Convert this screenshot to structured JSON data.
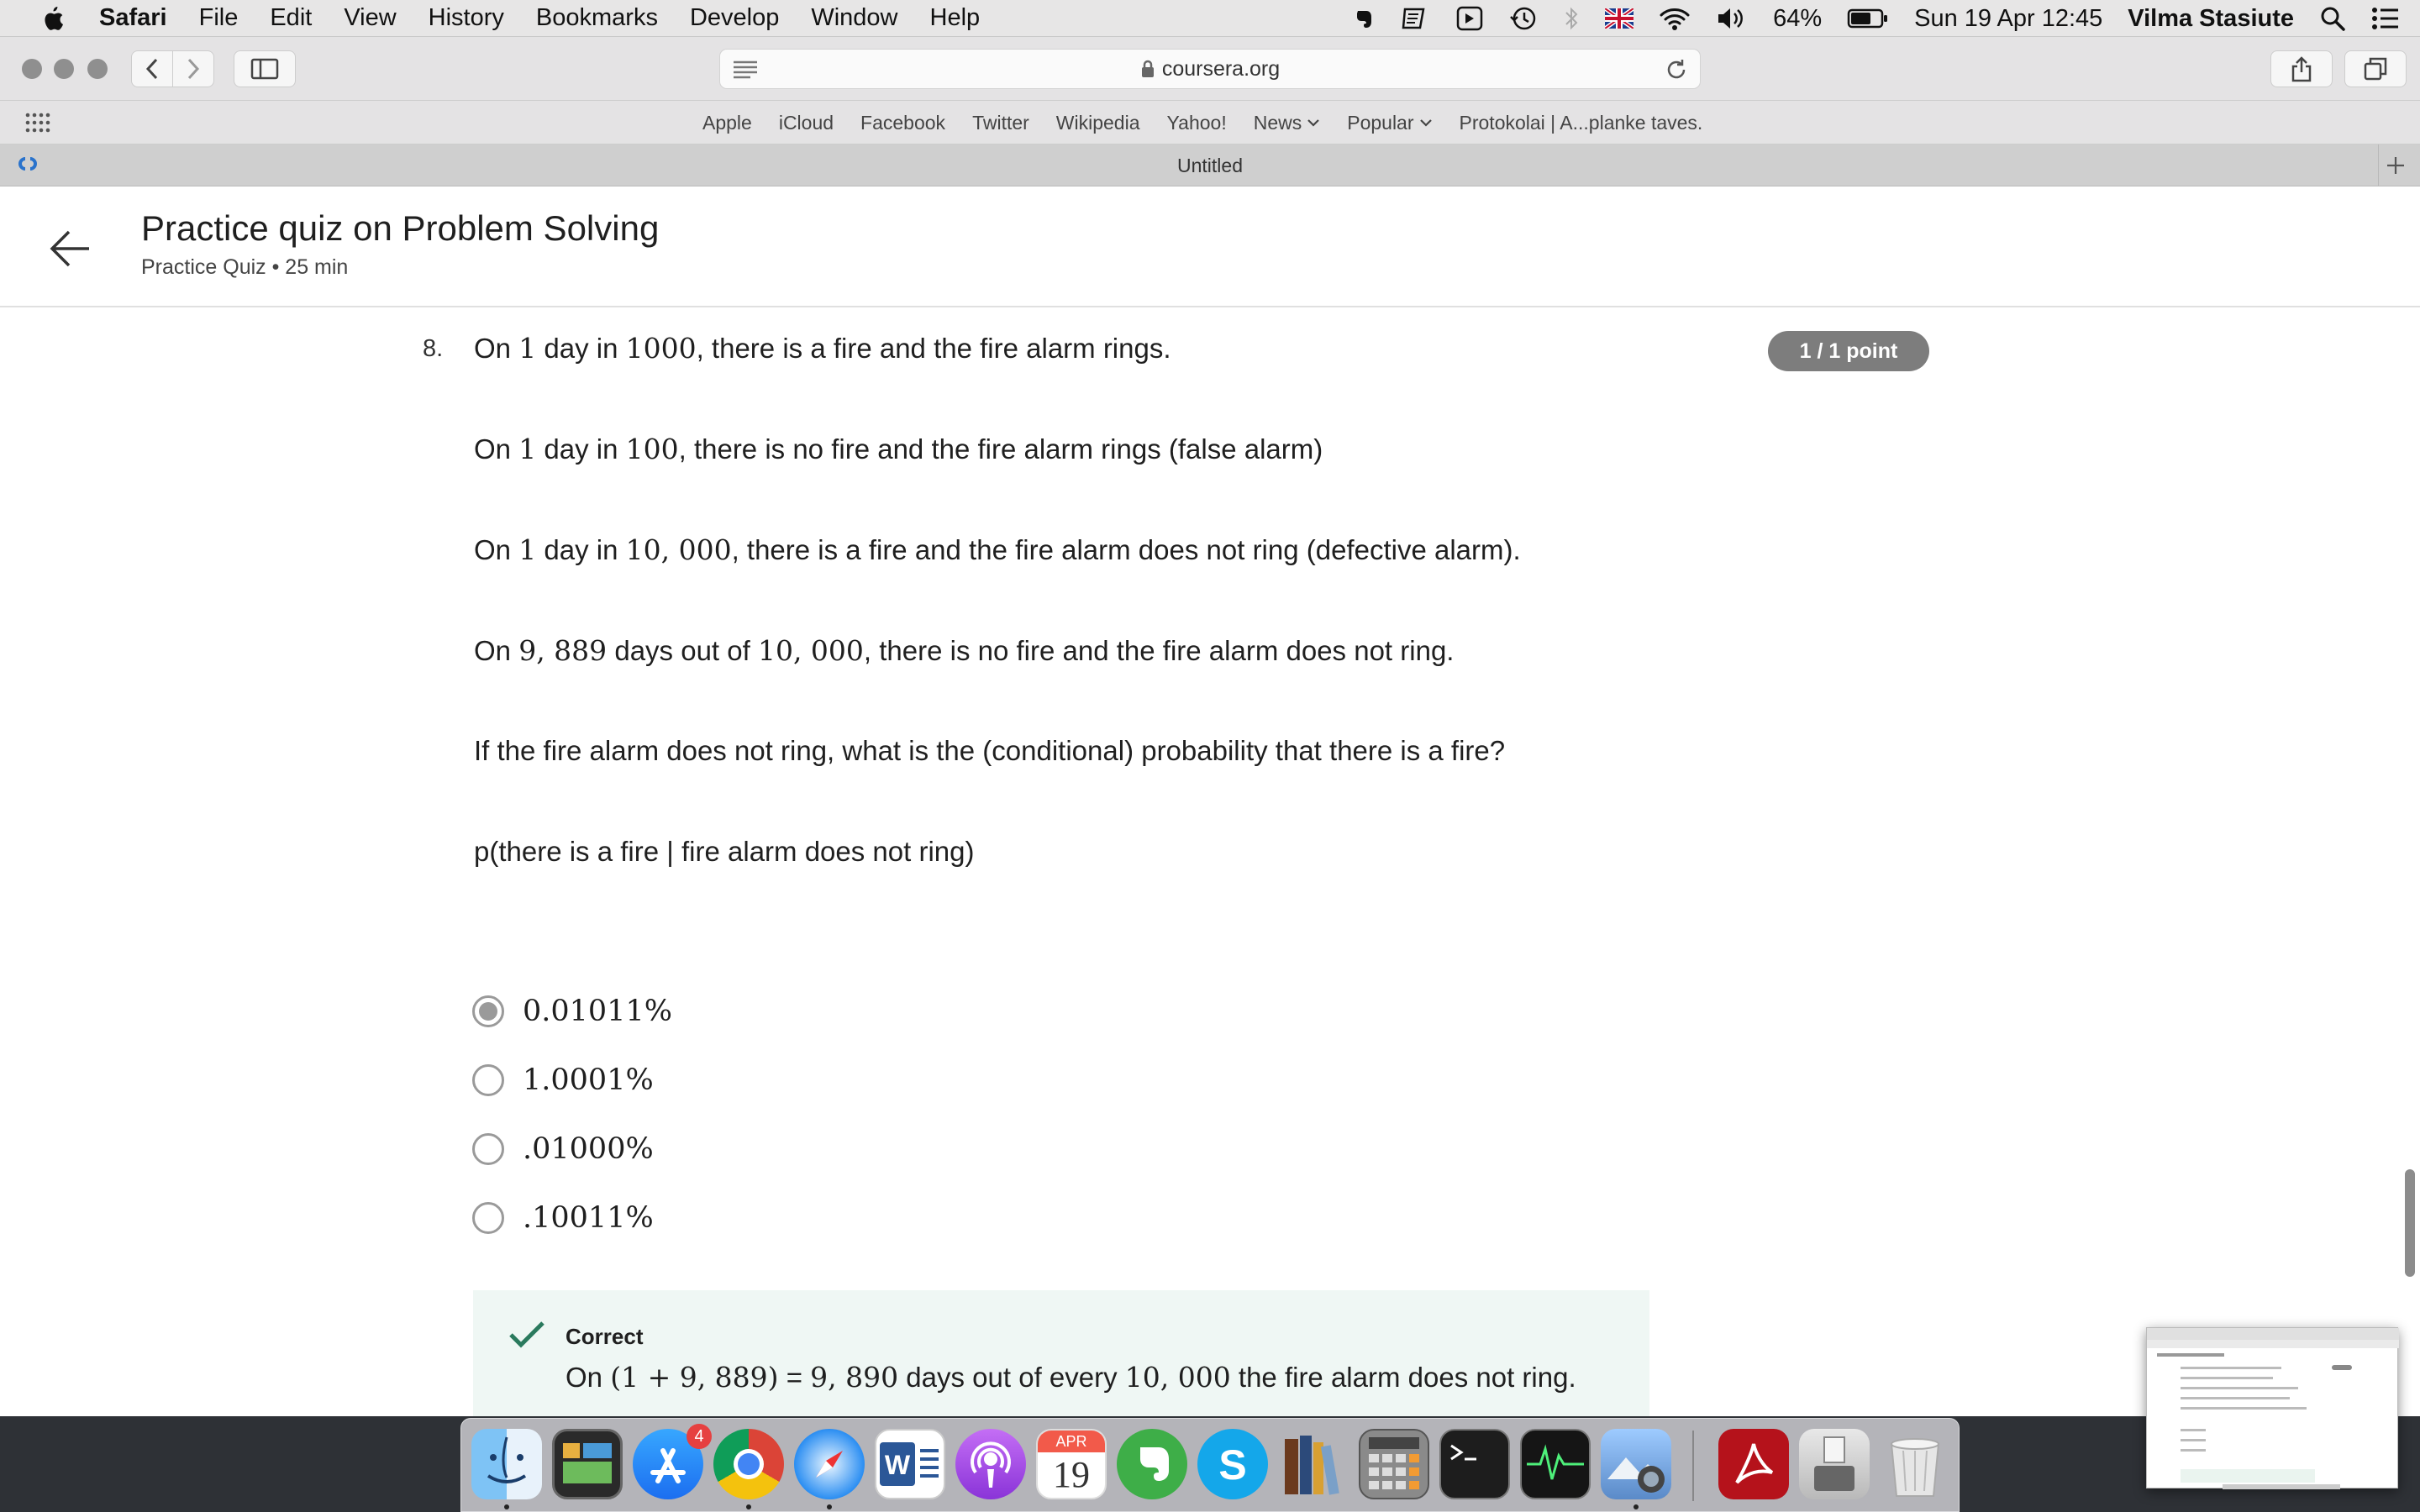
{
  "menubar": {
    "app_name": "Safari",
    "items": [
      "File",
      "Edit",
      "View",
      "History",
      "Bookmarks",
      "Develop",
      "Window",
      "Help"
    ],
    "battery": "64%",
    "datetime": "Sun 19 Apr  12:45",
    "user": "Vilma Stasiute"
  },
  "toolbar": {
    "url": "coursera.org"
  },
  "favorites": [
    "Apple",
    "iCloud",
    "Facebook",
    "Twitter",
    "Wikipedia",
    "Yahoo!",
    "News",
    "Popular",
    "Protokolai | A...planke taves."
  ],
  "tab": {
    "title": "Untitled"
  },
  "header": {
    "title": "Practice quiz on Problem Solving",
    "subtitle": "Practice Quiz • 25 min"
  },
  "question": {
    "number": "8.",
    "points": "1 / 1 point",
    "lines": [
      {
        "pre": "On ",
        "n1": "1",
        "mid": " day in ",
        "n2": "1000",
        "post": ", there is a fire and the fire alarm rings."
      },
      {
        "pre": "On ",
        "n1": "1",
        "mid": " day in ",
        "n2": "100",
        "post": ", there is no fire and the fire alarm rings (false alarm)"
      },
      {
        "pre": "On ",
        "n1": "1",
        "mid": " day in ",
        "n2": "10, 000",
        "post": ", there is a fire and the fire alarm does not ring (defective alarm)."
      },
      {
        "pre": "On ",
        "n1": "9, 889",
        "mid": " days out of ",
        "n2": "10, 000",
        "post": ", there is no fire and the fire alarm does not ring."
      }
    ],
    "prompt": "If the fire alarm does not ring, what is the (conditional) probability that there is a fire?",
    "expression": "p(there is a fire | fire alarm does not ring)",
    "options": [
      {
        "label": "0.01011%",
        "selected": true
      },
      {
        "label": "1.0001%",
        "selected": false
      },
      {
        "label": ".01000%",
        "selected": false
      },
      {
        "label": ".10011%",
        "selected": false
      }
    ]
  },
  "feedback": {
    "status": "Correct",
    "pre": "On ",
    "m1": "(1 + 9, 889)",
    "eq": " = ",
    "m2": "9, 890",
    "mid": " days out of every ",
    "m3": "10, 000",
    "post": " the fire alarm does not ring."
  },
  "dock": {
    "appstore_badge": "4",
    "calendar_month": "APR",
    "calendar_day": "19"
  },
  "colors": {
    "points_badge": "#7d7d7d",
    "feedback_bg": "#eff7f4",
    "check": "#2a7a5d",
    "coursera_blue": "#2a73cc"
  }
}
